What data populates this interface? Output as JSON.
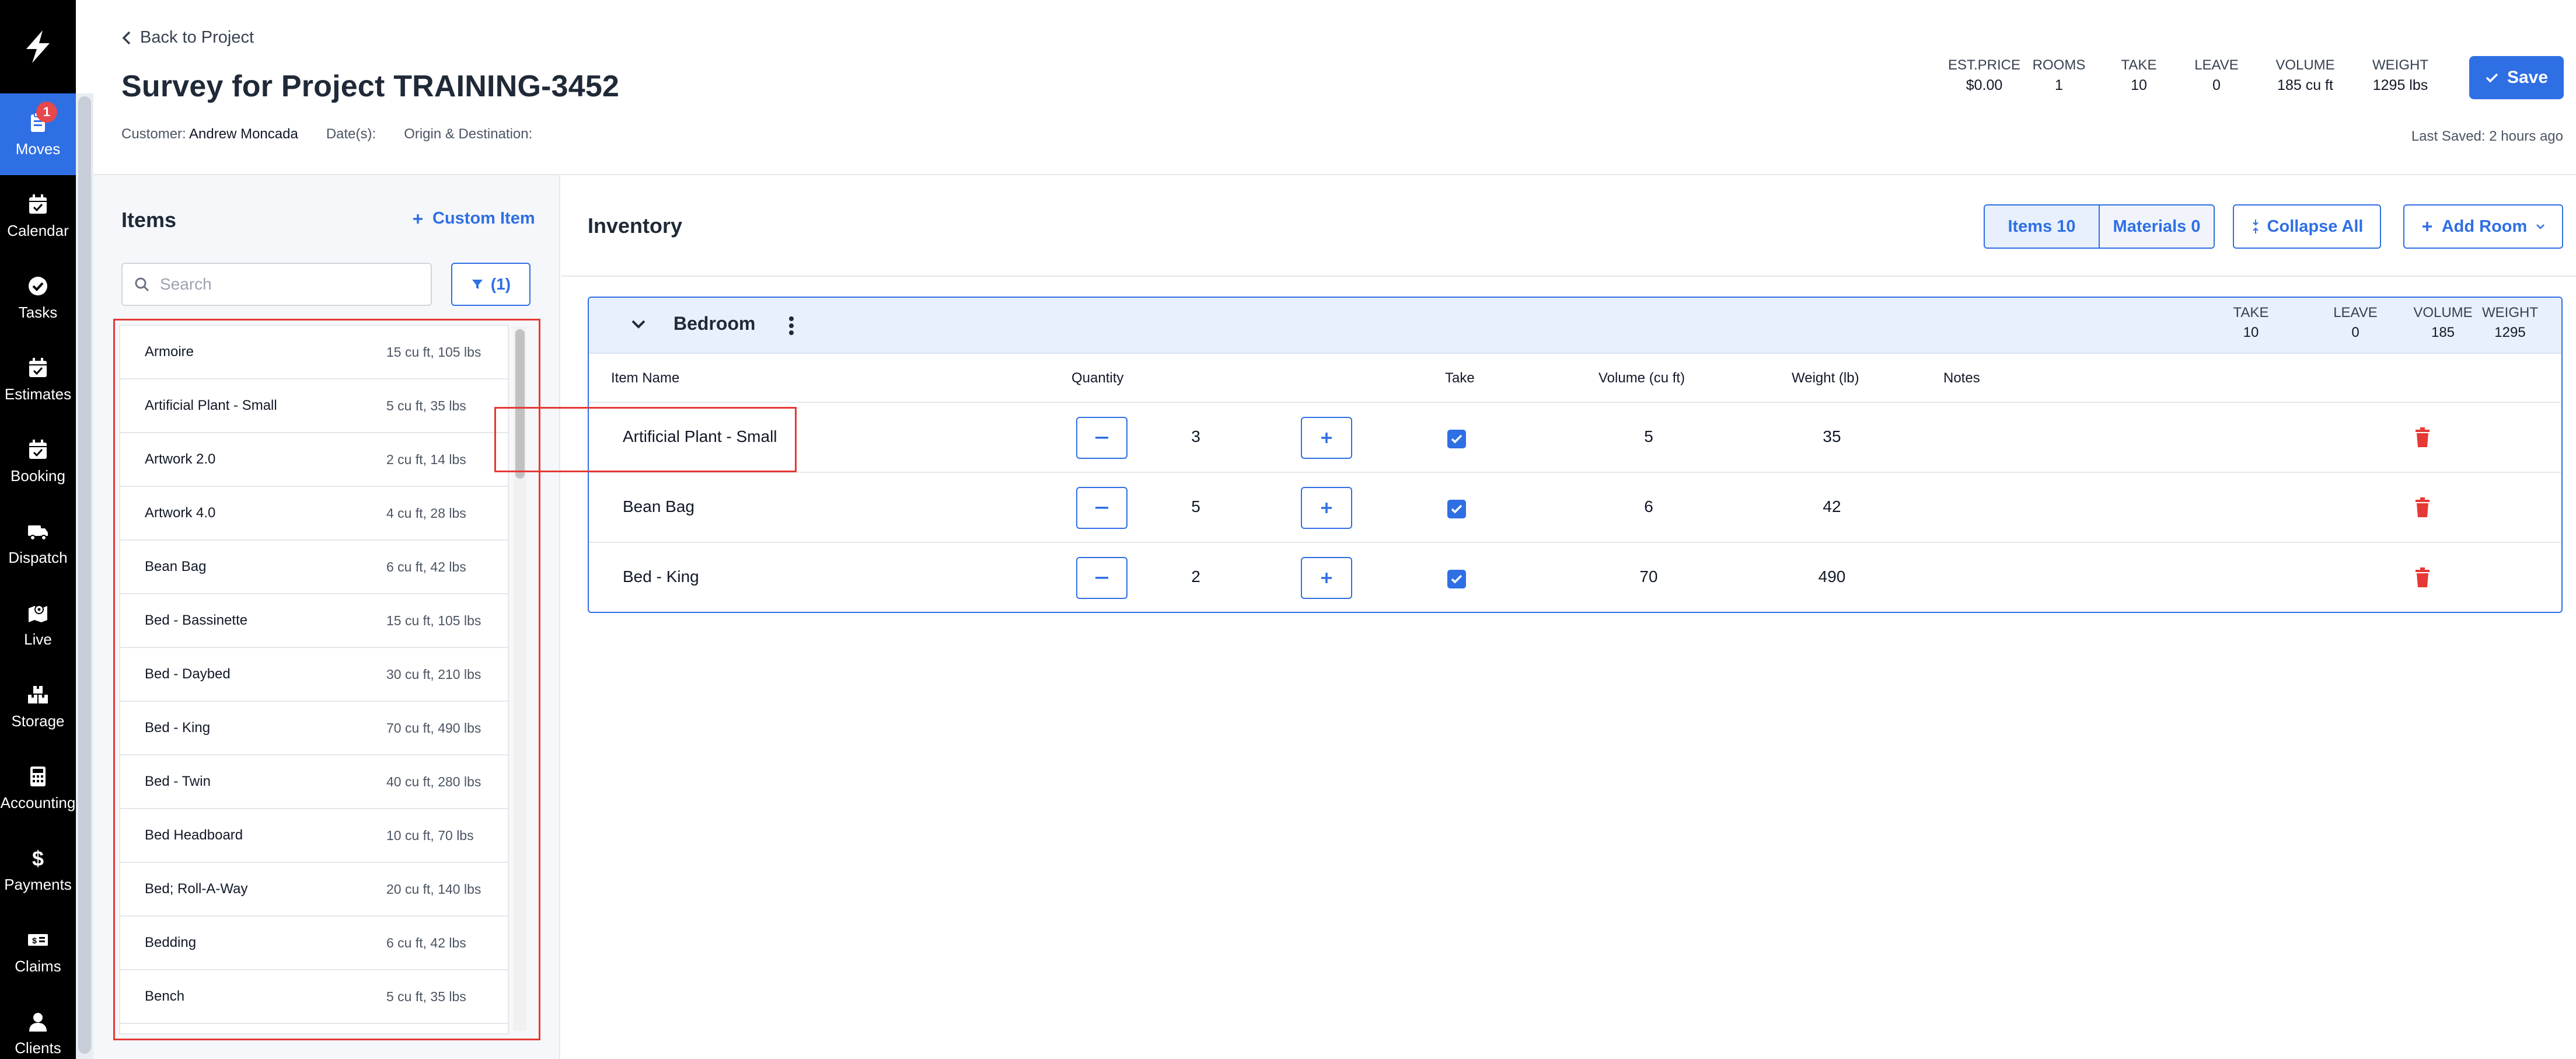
{
  "nav": {
    "items": [
      {
        "label": "Moves",
        "icon": "clipboard-icon",
        "badge": "1",
        "active": true
      },
      {
        "label": "Calendar",
        "icon": "calendar-check-icon"
      },
      {
        "label": "Tasks",
        "icon": "check-circle-icon"
      },
      {
        "label": "Estimates",
        "icon": "calendar-check-icon"
      },
      {
        "label": "Booking",
        "icon": "calendar-check-icon"
      },
      {
        "label": "Dispatch",
        "icon": "truck-icon"
      },
      {
        "label": "Live",
        "icon": "map-pin-icon"
      },
      {
        "label": "Storage",
        "icon": "boxes-icon"
      },
      {
        "label": "Accounting",
        "icon": "calculator-icon"
      },
      {
        "label": "Payments",
        "icon": "dollar-icon"
      },
      {
        "label": "Claims",
        "icon": "money-bill-icon"
      },
      {
        "label": "Clients",
        "icon": "user-icon"
      }
    ]
  },
  "header": {
    "back_label": "Back to Project",
    "title": "Survey for Project TRAINING-3452",
    "customer_label": "Customer:",
    "customer_name": "Andrew Moncada",
    "dates_label": "Date(s):",
    "origin_label": "Origin & Destination:",
    "stats": [
      {
        "label": "EST.PRICE",
        "value": "$0.00"
      },
      {
        "label": "ROOMS",
        "value": "1"
      },
      {
        "label": "TAKE",
        "value": "10"
      },
      {
        "label": "LEAVE",
        "value": "0"
      },
      {
        "label": "VOLUME",
        "value": "185 cu ft"
      },
      {
        "label": "WEIGHT",
        "value": "1295 lbs"
      }
    ],
    "save_label": "Save",
    "last_saved": "Last Saved: 2 hours ago"
  },
  "items_panel": {
    "title": "Items",
    "custom_item_label": "Custom Item",
    "search_placeholder": "Search",
    "filter_label": "(1)",
    "list": [
      {
        "name": "Armoire",
        "detail": "15 cu ft, 105 lbs"
      },
      {
        "name": "Artificial Plant - Small",
        "detail": "5 cu ft, 35 lbs"
      },
      {
        "name": "Artwork 2.0",
        "detail": "2 cu ft, 14 lbs"
      },
      {
        "name": "Artwork 4.0",
        "detail": "4 cu ft, 28 lbs"
      },
      {
        "name": "Bean Bag",
        "detail": "6 cu ft, 42 lbs"
      },
      {
        "name": "Bed - Bassinette",
        "detail": "15 cu ft, 105 lbs"
      },
      {
        "name": "Bed - Daybed",
        "detail": "30 cu ft, 210 lbs"
      },
      {
        "name": "Bed - King",
        "detail": "70 cu ft, 490 lbs"
      },
      {
        "name": "Bed - Twin",
        "detail": "40 cu ft, 280 lbs"
      },
      {
        "name": "Bed Headboard",
        "detail": "10 cu ft, 70 lbs"
      },
      {
        "name": "Bed; Roll-A-Way",
        "detail": "20 cu ft, 140 lbs"
      },
      {
        "name": "Bedding",
        "detail": "6 cu ft, 42 lbs"
      },
      {
        "name": "Bench",
        "detail": "5 cu ft, 35 lbs"
      }
    ]
  },
  "inventory": {
    "title": "Inventory",
    "items_tab": "Items 10",
    "materials_tab": "Materials 0",
    "collapse_label": "Collapse All",
    "add_room_label": "Add Room",
    "room": {
      "name": "Bedroom",
      "stats": [
        {
          "label": "TAKE",
          "value": "10"
        },
        {
          "label": "LEAVE",
          "value": "0"
        },
        {
          "label": "VOLUME",
          "value": "185"
        },
        {
          "label": "WEIGHT",
          "value": "1295"
        }
      ],
      "columns": [
        "Item Name",
        "Quantity",
        "Take",
        "Volume (cu ft)",
        "Weight (lb)",
        "Notes"
      ],
      "rows": [
        {
          "name": "Artificial Plant - Small",
          "qty": "3",
          "volume": "5",
          "weight": "35",
          "take": true
        },
        {
          "name": "Bean Bag",
          "qty": "5",
          "volume": "6",
          "weight": "42",
          "take": true
        },
        {
          "name": "Bed - King",
          "qty": "2",
          "volume": "70",
          "weight": "490",
          "take": true
        }
      ]
    }
  },
  "colors": {
    "accent": "#2f6fe4",
    "nav_bg": "#000000",
    "danger": "#e53935",
    "badge": "#e5484d"
  }
}
